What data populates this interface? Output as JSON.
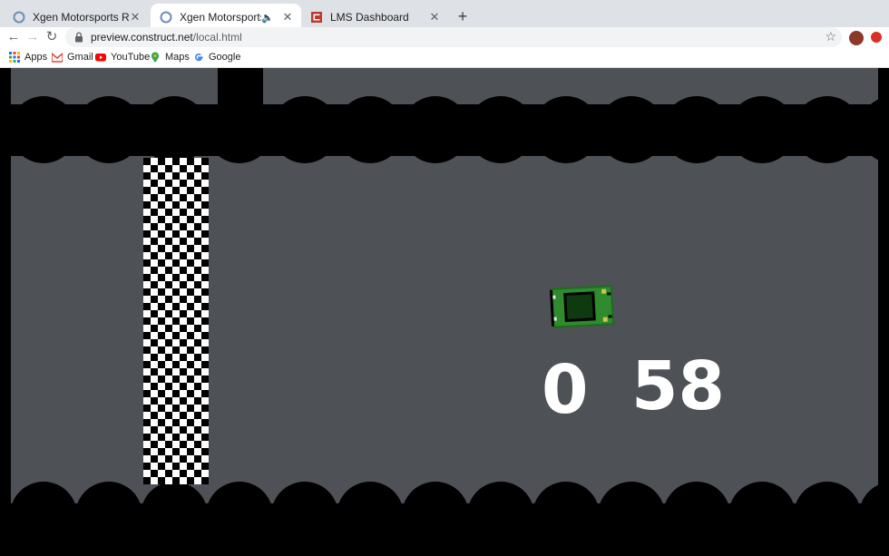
{
  "browser": {
    "tabs": [
      {
        "title": "Xgen Motorsports Racing - Co",
        "active": false,
        "audio": false
      },
      {
        "title": "Xgen Motorsports Racing",
        "active": true,
        "audio": true
      },
      {
        "title": "LMS Dashboard",
        "active": false,
        "audio": false
      }
    ],
    "url_host": "preview.construct.net",
    "url_path": "/local.html",
    "bookmarks": [
      {
        "label": "Apps",
        "icon": "apps-grid-icon"
      },
      {
        "label": "Gmail",
        "icon": "gmail-icon"
      },
      {
        "label": "YouTube",
        "icon": "youtube-icon"
      },
      {
        "label": "Maps",
        "icon": "maps-pin-icon"
      },
      {
        "label": "Google",
        "icon": "google-icon"
      }
    ]
  },
  "game": {
    "laps": "0",
    "timer": "58",
    "colors": {
      "track": "#4e5256",
      "wall": "#000000",
      "car_body": "#2e8b2e",
      "car_roof": "#0f3a0f",
      "score_text": "#ffffff"
    }
  }
}
